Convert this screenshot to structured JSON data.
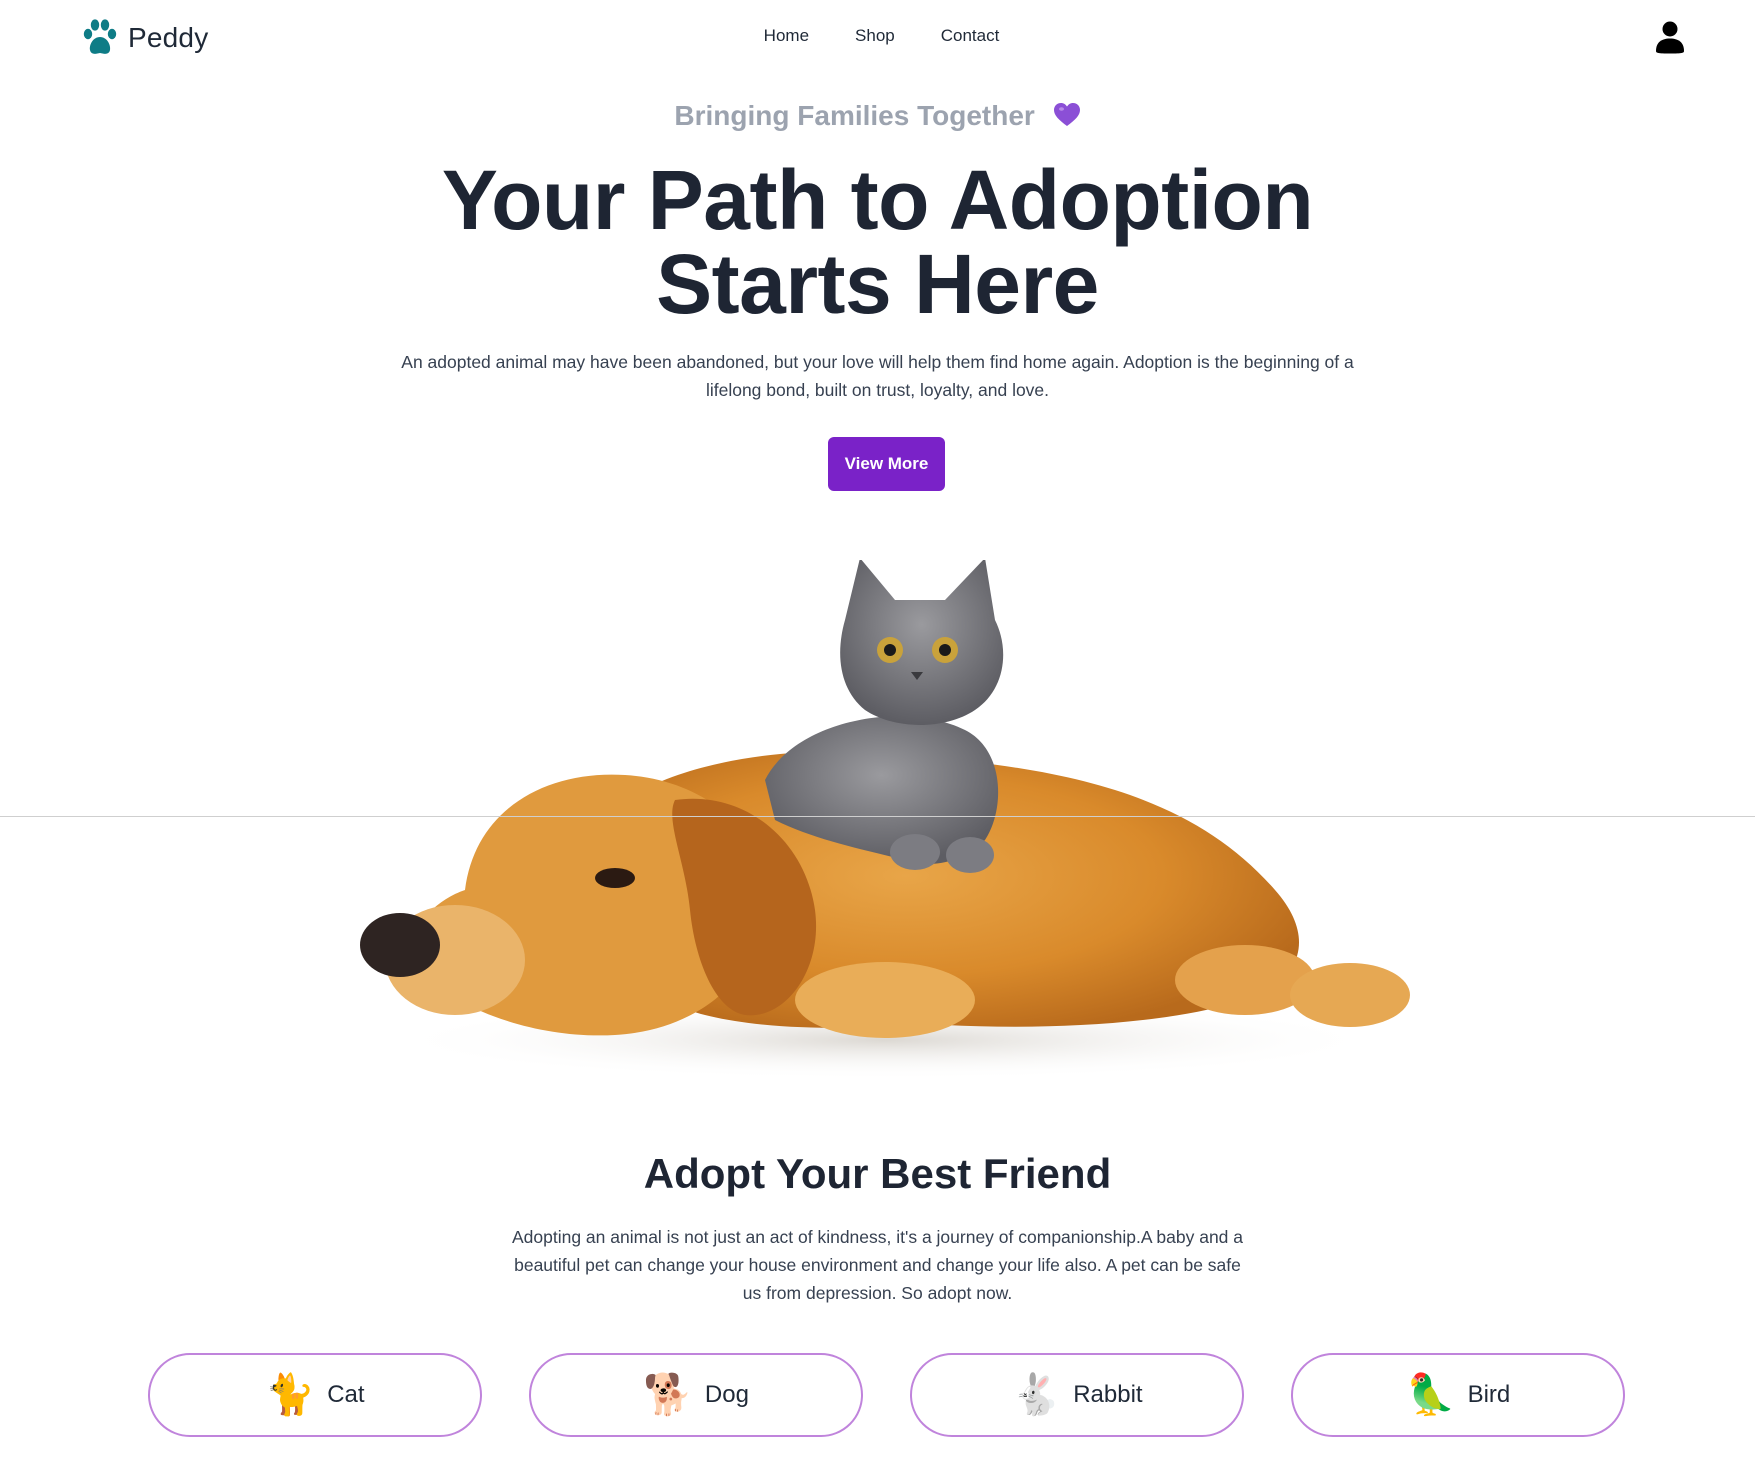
{
  "brand": {
    "name": "Peddy",
    "logo_icon": "paw-icon",
    "logo_color": "#0e7c86"
  },
  "nav": {
    "items": [
      "Home",
      "Shop",
      "Contact"
    ]
  },
  "header": {
    "user_icon": "user-icon"
  },
  "hero": {
    "tagline": "Bringing Families Together",
    "tagline_icon": "purple-heart-icon",
    "title_line1": "Your Path to Adoption",
    "title_line2": "Starts Here",
    "description": "An adopted animal may have been abandoned, but your love will help them find home again. Adoption is the beginning of a lifelong bond, built on trust, loyalty, and love.",
    "cta_label": "View More",
    "image_alt": "golden-retriever-and-gray-kitten-image"
  },
  "adopt": {
    "title": "Adopt Your Best Friend",
    "description": "Adopting an animal is not just an act of kindness, it's a journey of companionship.A baby and a beautiful pet can change your house environment and change your life also. A pet can be safe us from depression. So adopt now.",
    "categories": [
      {
        "label": "Cat",
        "icon": "🐈"
      },
      {
        "label": "Dog",
        "icon": "🐕"
      },
      {
        "label": "Rabbit",
        "icon": "🐇"
      },
      {
        "label": "Bird",
        "icon": "🦜"
      }
    ]
  },
  "colors": {
    "accent": "#7a22c8",
    "pill_border": "#c084dc",
    "heading": "#1e2533",
    "muted": "#9ca3af"
  }
}
